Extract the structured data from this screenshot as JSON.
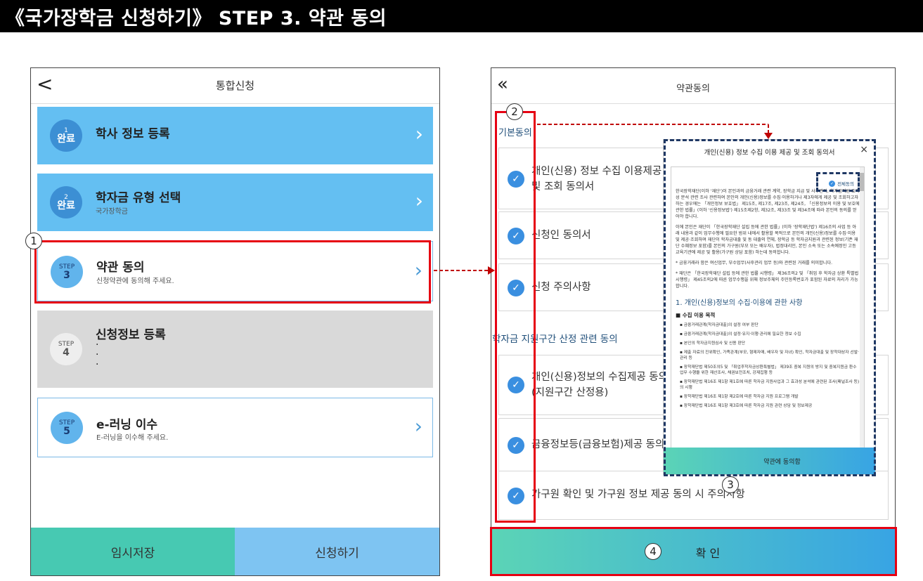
{
  "page_title": "《국가장학금 신청하기》 STEP 3. 약관 동의",
  "left_phone": {
    "back_glyph": "<",
    "title": "통합신청",
    "cards": [
      {
        "badge_top": "1",
        "badge_bottom": "완료",
        "title": "학사 정보 등록",
        "subtitle": ""
      },
      {
        "badge_top": "2",
        "badge_bottom": "완료",
        "title": "학자금 유형 선택",
        "subtitle": "국가장학금"
      },
      {
        "badge_top": "STEP",
        "badge_bottom": "3",
        "title": "약관 동의",
        "subtitle": "신청약관에 동의해 주세요."
      },
      {
        "badge_top": "STEP",
        "badge_bottom": "4",
        "title": "신청정보 등록",
        "subtitle": "·\n·\n·"
      },
      {
        "badge_top": "STEP",
        "badge_bottom": "5",
        "title": "e-러닝 이수",
        "subtitle": "E-러닝을 이수해 주세요."
      }
    ],
    "temp_save": "임시저장",
    "apply": "신청하기"
  },
  "right_phone": {
    "back_glyph": "«",
    "title": "약관동의",
    "basic_section": "기본동의",
    "basic_items": [
      "개인(신용) 정보 수집 이용제공\n및 조회 동의서",
      "신청인 동의서",
      "신청 주의사항"
    ],
    "support_section": "학자금 지원구간 산정 관련 동의",
    "support_items": [
      "개인(신용)정보의 수집제공 동의서\n(지원구간 산정용)",
      "금융정보등(금융보험)제공 동의서",
      "가구원 확인 및 가구원 정보 제공 동의 시 주의사항"
    ],
    "confirm": "확 인"
  },
  "modal": {
    "title": "개인(신용) 정보 수집 이용 제공 및 조회 동의서",
    "close": "×",
    "all_agree": "전체동의",
    "para1": "한국장학재단(이하 '재단')이 본인과의 금융거래 관련 계약, 장학금 지급 및 사후관리, 학자금지원 효과성 분석 관련 조사 관련하여 본인의 개인(신용)정보를 수집·이용하거나 제3자에게 제공 및 조회하고자 하는 경우에는 「개인정보 보호법」 제15조, 제17조, 제23조, 제24조, 「신용정보의 이용 및 보호에 관한 법률」(이하 '신용정보법') 제15조제2항, 제32조, 제33조 및 제34조에 따라 본인의 동의를 얻어야 합니다.",
    "para2": "이에 본인은 재단이 「한국장학재단 설립 등에 관한 법률」(이하 '장학재단법') 제16조의 사업 등 아래 내용과 같이 업무수행에 필요한 범위 내에서 활용할 목적으로 본인의 개인(신용)정보를 수집·이용 및 제공·조회하며 재단이 학자금대출 및 동 대출의 연체, 장학금 등 학자금지원과 관련된 정보(기존 재단 수혜정보 포함)를 본인의 가구원(부모 또는 배우자), 법정대리인, 본인 소속 또는 소속예정인 고등교육기관에 제공 및 활용(가구원 상담 포함) 하는데 동의합니다.",
    "note1": "* 금융거래라 함은 여신업무, 부수업무(사후관리 업무 등)와 관련된 거래를 의미합니다.",
    "note2": "* 재단은 「한국장학재단 설립 등에 관한 법률 시행령」 제36조의2 및 「취업 후 학자금 상환 특별법 시행령」 제45조의2에 따른 업무수행을 위해 정보주체의 주민등록번호가 포함된 자료의 처리가 가능합니다.",
    "section_heading": "1. 개인(신용)정보의 수집·이용에 관한 사항",
    "subheading": "■ 수집 이용 목적",
    "list": [
      "▪ 금융거래관계(학자금대출)의 설정 여부 판단",
      "▪ 금융거래관계(학자금대출)의 설정·유지·이행·관리에 필요한 정보 수집",
      "▪ 본인의 학자금지원심사 및 신용 판단",
      "▪ 제출 자료의 진위확인, 가족관계(부모, 형제자매, 배우자 및 자녀) 확인, 학자금대출 및 장학대상자 선발·관리 등",
      "▪ 장학재단법 제50조의5 및 「취업후학자금상환특별법」 제39조 중복 지원의 방지 및 중복지원금 환수 업무 수행을 위한 재산조사, 채권보전조치, 강제집행 등",
      "▪ 장학재단법 제16조 제1항 제1호에 따른 학자금 지원사업과 그 효과성 분석에 관련된 조사(패널조사 등)의 시행",
      "▪ 장학재단법 제16조 제1항 제2호에 따른 학자금 지원 프로그램 개발",
      "▪ 장학재단법 제16조 제1항 제3호에 따른 학자금 지원 관련 상담 및 정보제공"
    ],
    "agree_button": "약관에 동의함"
  },
  "annotations": {
    "n1": "1",
    "n2": "2",
    "n3": "3",
    "n4": "4"
  },
  "colors": {
    "accent_blue": "#64bff2",
    "highlight_red": "#e60012",
    "dashed_navy": "#1f3864",
    "check_blue": "#3a8fe0",
    "save_green": "#47c9b2",
    "apply_blue": "#7ec4f2"
  }
}
